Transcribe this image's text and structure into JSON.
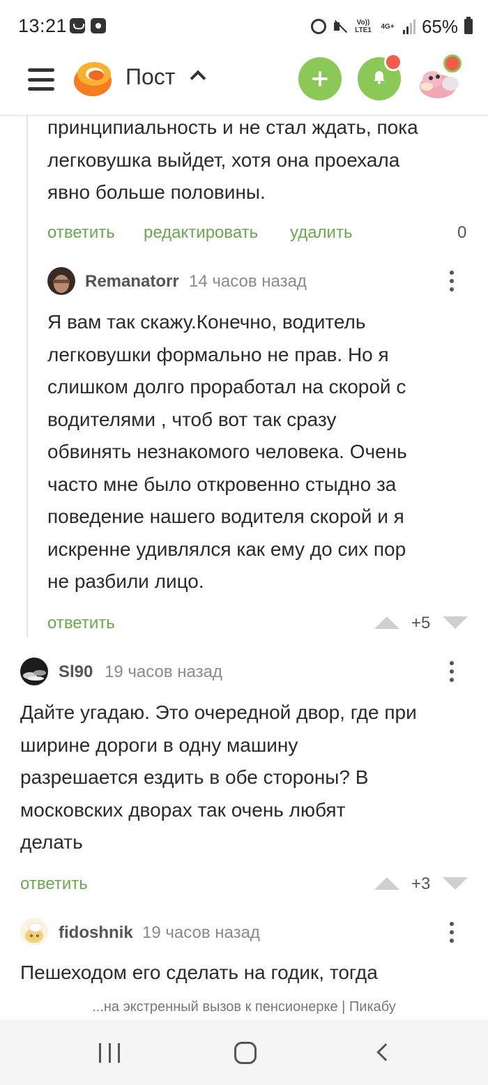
{
  "status_bar": {
    "time": "13:21",
    "network_volte": "Vo)) LTE1",
    "network_4g": "4G+",
    "battery": "65%"
  },
  "header": {
    "title": "Пост",
    "icons": [
      "menu-icon",
      "pikabu-logo",
      "chevron-up-icon",
      "plus-icon",
      "bell-icon",
      "user-avatar"
    ],
    "accent_color": "#8ac858",
    "badge_color": "#f25c4a"
  },
  "prev_comment": {
    "lines": [
      "принципиальность и не стал ждать, пока",
      "легковушка выйдет, хотя она проехала",
      "явно больше половины."
    ],
    "actions": {
      "reply": "ответить",
      "edit": "редактировать",
      "delete": "удалить"
    },
    "score": "0"
  },
  "comments": [
    {
      "author": "Remanatorr",
      "time": "14 часов назад",
      "lines": [
        "Я вам так скажу.Конечно, водитель",
        "легковушки формально не прав. Но я",
        "слишком долго проработал на скорой с",
        "водителями , чтоб вот так сразу",
        "обвинять незнакомого человека. Очень",
        "часто мне было откровенно стыдно за",
        "поведение нашего водителя скорой и я",
        "искренне удивлялся как ему до сих пор",
        "не разбили лицо."
      ],
      "reply": "ответить",
      "score": "+5"
    },
    {
      "author": "Sl90",
      "time": "19 часов назад",
      "lines": [
        "Дайте угадаю. Это очередной двор, где при",
        "ширине дороги в одну машину",
        "разрешается ездить в обе стороны? В",
        "московских дворах так очень любят",
        "делать"
      ],
      "reply": "ответить",
      "score": "+3"
    },
    {
      "author": "fidoshnik",
      "time": "19 часов назад",
      "lines": [
        "Пешеходом его сделать на годик, тогда"
      ]
    }
  ],
  "url_bar": "...на экстренный вызов к пенсионерке | Пикабу",
  "link_color": "#6aa84f"
}
